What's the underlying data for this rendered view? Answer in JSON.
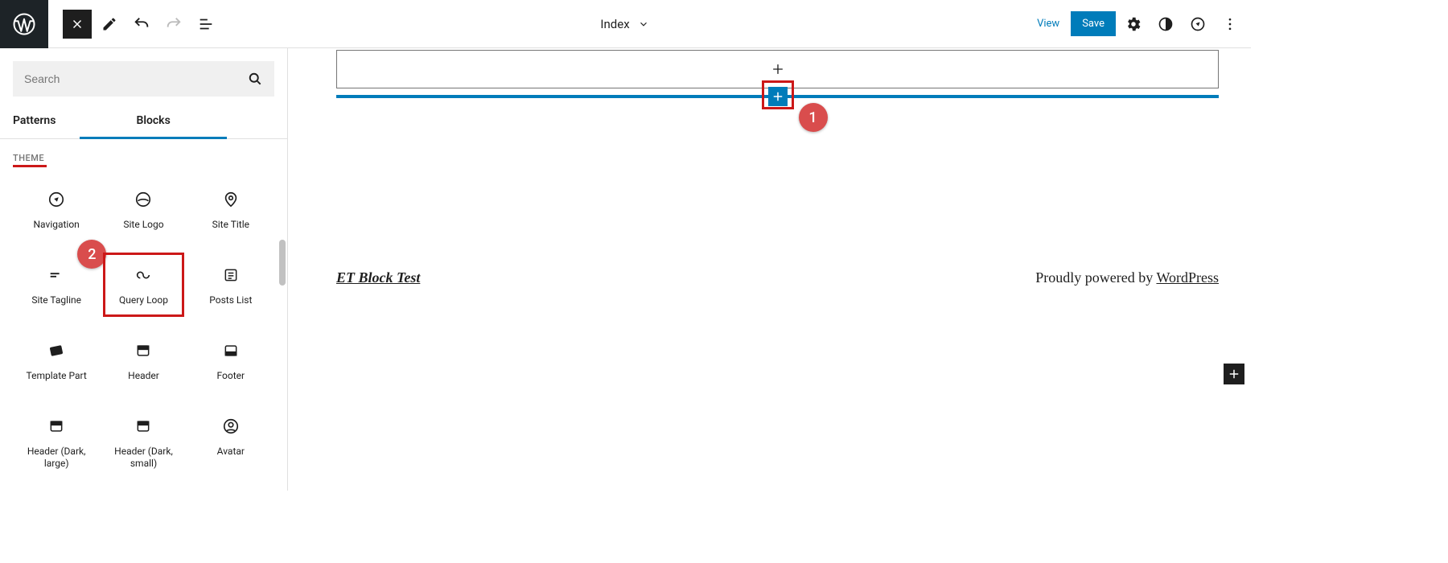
{
  "topbar": {
    "title": "Index",
    "view_label": "View",
    "save_label": "Save"
  },
  "inserter": {
    "search_placeholder": "Search",
    "tabs": {
      "patterns": "Patterns",
      "blocks": "Blocks"
    },
    "section": "THEME",
    "blocks": [
      {
        "label": "Navigation"
      },
      {
        "label": "Site Logo"
      },
      {
        "label": "Site Title"
      },
      {
        "label": "Site Tagline"
      },
      {
        "label": "Query Loop"
      },
      {
        "label": "Posts List"
      },
      {
        "label": "Template Part"
      },
      {
        "label": "Header"
      },
      {
        "label": "Footer"
      },
      {
        "label": "Header (Dark, large)"
      },
      {
        "label": "Header (Dark, small)"
      },
      {
        "label": "Avatar"
      }
    ]
  },
  "canvas": {
    "footer_left": "ET Block Test",
    "footer_right_prefix": "Proudly powered by ",
    "footer_right_link": "WordPress"
  },
  "annotations": {
    "badge1": "1",
    "badge2": "2"
  }
}
